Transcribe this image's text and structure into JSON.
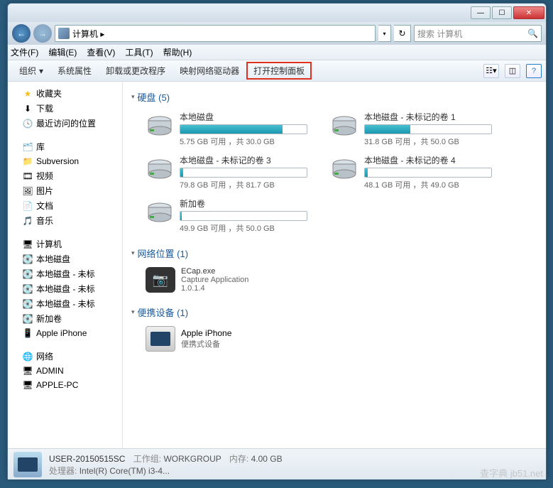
{
  "titlebar": {
    "min": "—",
    "max": "☐",
    "close": "✕"
  },
  "addressbar": {
    "back": "←",
    "fwd": "→",
    "path": "计算机 ▸",
    "dropdown": "▾",
    "refresh": "↻"
  },
  "search": {
    "placeholder": "搜索 计算机",
    "icon": "🔍"
  },
  "menubar": {
    "file": "文件(F)",
    "edit": "编辑(E)",
    "view": "查看(V)",
    "tools": "工具(T)",
    "help": "帮助(H)"
  },
  "toolbar": {
    "organize": "组织",
    "org_arrow": "▾",
    "props": "系统属性",
    "uninstall": "卸载或更改程序",
    "mapdrive": "映射网络驱动器",
    "controlpanel": "打开控制面板",
    "help": "?"
  },
  "sidebar": {
    "favorites": {
      "label": "收藏夹",
      "items": [
        {
          "icon": "⬇",
          "label": "下载"
        },
        {
          "icon": "🕓",
          "label": "最近访问的位置"
        }
      ]
    },
    "libraries": {
      "label": "库",
      "items": [
        {
          "icon": "📁",
          "label": "Subversion"
        },
        {
          "icon": "🎞",
          "label": "视频"
        },
        {
          "icon": "🖼",
          "label": "图片"
        },
        {
          "icon": "📄",
          "label": "文档"
        },
        {
          "icon": "🎵",
          "label": "音乐"
        }
      ]
    },
    "computer": {
      "label": "计算机",
      "items": [
        {
          "icon": "💽",
          "label": "本地磁盘"
        },
        {
          "icon": "💽",
          "label": "本地磁盘 - 未标"
        },
        {
          "icon": "💽",
          "label": "本地磁盘 - 未标"
        },
        {
          "icon": "💽",
          "label": "本地磁盘 - 未标"
        },
        {
          "icon": "💽",
          "label": "新加卷"
        },
        {
          "icon": "📱",
          "label": "Apple iPhone"
        }
      ]
    },
    "network": {
      "label": "网络",
      "items": [
        {
          "icon": "🖥",
          "label": "ADMIN"
        },
        {
          "icon": "🖥",
          "label": "APPLE-PC"
        }
      ]
    }
  },
  "sections": {
    "drives": {
      "label": "硬盘 (5)",
      "items": [
        {
          "name": "本地磁盘",
          "stat": "5.75 GB 可用 ，共 30.0 GB",
          "fill": 81
        },
        {
          "name": "本地磁盘 - 未标记的卷 1",
          "stat": "31.8 GB 可用 ，共 50.0 GB",
          "fill": 36
        },
        {
          "name": "本地磁盘 - 未标记的卷 3",
          "stat": "79.8 GB 可用 ，共 81.7 GB",
          "fill": 2
        },
        {
          "name": "本地磁盘 - 未标记的卷 4",
          "stat": "48.1 GB 可用 ，共 49.0 GB",
          "fill": 2
        },
        {
          "name": "新加卷",
          "stat": "49.9 GB 可用 ，共 50.0 GB",
          "fill": 1
        }
      ]
    },
    "network": {
      "label": "网络位置 (1)",
      "item": {
        "name": "ECap.exe",
        "line2": "Capture Application",
        "line3": "1.0.1.4"
      }
    },
    "portable": {
      "label": "便携设备 (1)",
      "item": {
        "name": "Apple iPhone",
        "line2": "便携式设备"
      }
    }
  },
  "statusbar": {
    "name": "USER-20150515SC",
    "wg_lbl": "工作组:",
    "wg": "WORKGROUP",
    "mem_lbl": "内存:",
    "mem": "4.00 GB",
    "cpu_lbl": "处理器:",
    "cpu": "Intel(R) Core(TM) i3-4..."
  },
  "watermark": "查字典 jb51.net"
}
